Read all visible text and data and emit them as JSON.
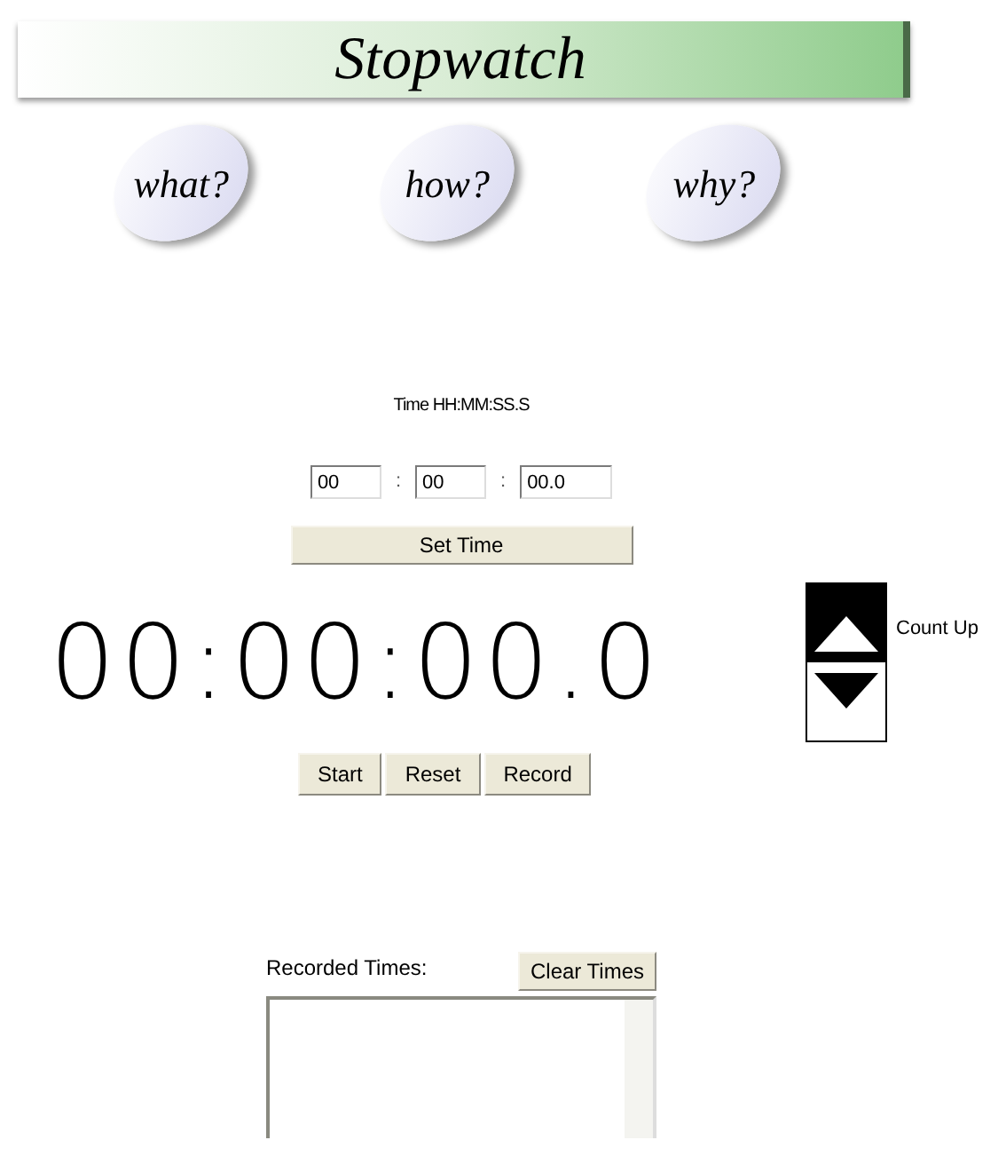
{
  "banner": {
    "title": "Stopwatch"
  },
  "links": [
    "what?",
    "how?",
    "why?"
  ],
  "time_label": "Time HH:MM:SS.S",
  "inputs": [
    {
      "value": "00"
    },
    {
      "value": "00"
    },
    {
      "value": "00.0"
    }
  ],
  "separators": [
    ":",
    ":"
  ],
  "set_time_button": "Set Time",
  "display": "00:00:00.0",
  "direction": [
    {
      "kind": "up",
      "selected": true
    },
    {
      "kind": "down",
      "selected": false
    }
  ],
  "direction_label": "Count Up",
  "buttons": [
    "Start",
    "Reset",
    "Record"
  ],
  "recorded": {
    "label": "Recorded Times:",
    "clear_button": "Clear Times"
  }
}
